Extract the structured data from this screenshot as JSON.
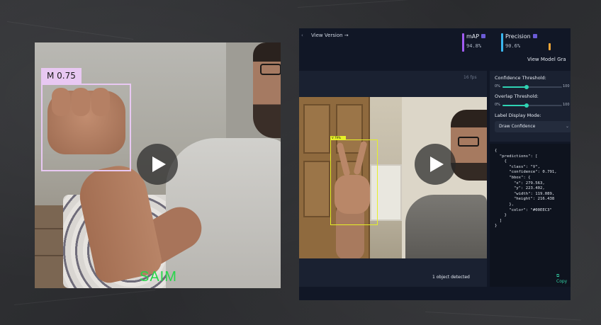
{
  "left_video": {
    "detection_label": "M 0.75",
    "watermark": "SAIM",
    "play_icon": "play-icon"
  },
  "right_app": {
    "view_version": "View Version →",
    "metrics": [
      {
        "label": "mAP",
        "value": "94.8%",
        "color": "#a25cf2"
      },
      {
        "label": "Precision",
        "value": "90.6%",
        "color": "#39b7f0"
      }
    ],
    "view_model_graphs": "View Model Gra",
    "fps": "16 fps",
    "detection_label": "V 79%",
    "objects_detected": "1 object detected",
    "controls": {
      "confidence_label": "Confidence Threshold:",
      "confidence_min": "0%",
      "confidence_max": "100",
      "confidence_value": 0.4,
      "overlap_label": "Overlap Threshold:",
      "overlap_min": "0%",
      "overlap_max": "100",
      "overlap_value": 0.4,
      "label_display_label": "Label Display Mode:",
      "label_display_value": "Draw Confidence"
    },
    "json_output": "{\n  \"predictions\": [\n    {\n      \"class\": \"V\",\n      \"confidence\": 0.791,\n      \"bbox\": {\n        \"x\": 279.563,\n        \"y\": 223.402,\n        \"width\": 119.089,\n        \"height\": 216.438\n      },\n      \"color\": \"#00EEC3\"\n    }\n  ]\n}",
    "copy_label": "Copy"
  },
  "colors": {
    "accent_teal": "#2fd3b3",
    "left_bbox": "#e8c8f2",
    "right_bbox": "#e6f028",
    "watermark": "#27d64a"
  }
}
